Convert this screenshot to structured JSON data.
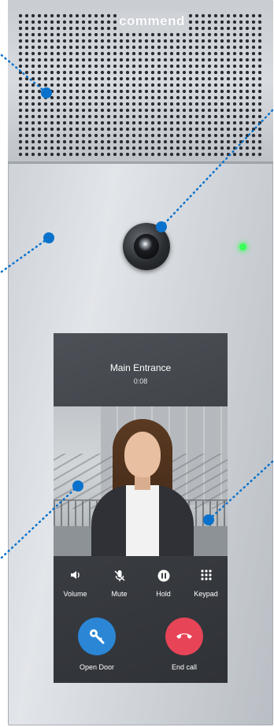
{
  "brand": {
    "text": "commend"
  },
  "call": {
    "title": "Main Entrance",
    "duration": "0:08"
  },
  "controls": [
    {
      "label": "Volume",
      "icon": "speaker-icon"
    },
    {
      "label": "Mute",
      "icon": "microphone-off-icon"
    },
    {
      "label": "Hold",
      "icon": "pause-icon"
    },
    {
      "label": "Keypad",
      "icon": "keypad-icon"
    }
  ],
  "actions": {
    "open_door": {
      "label": "Open Door",
      "icon": "key-icon",
      "color": "#2b86d6"
    },
    "end_call": {
      "label": "End call",
      "icon": "phone-hangup-icon",
      "color": "#e74457"
    }
  },
  "hotspot_color": "#0a72cc",
  "led_color": "#3bff5a"
}
